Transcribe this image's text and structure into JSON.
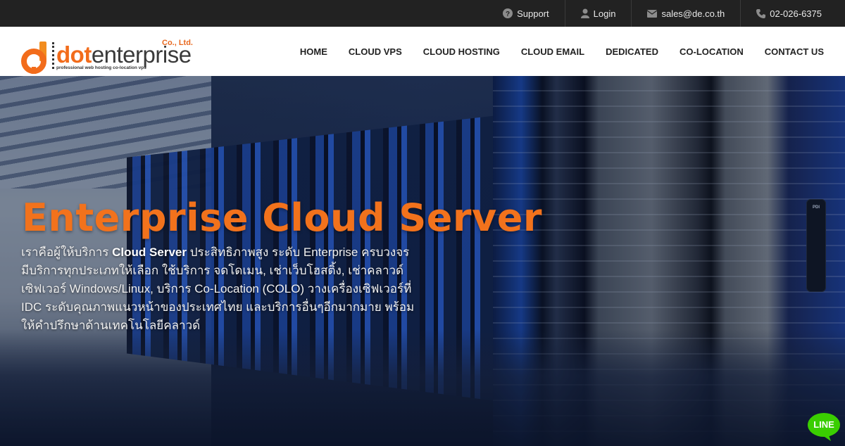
{
  "topbar": {
    "items": [
      {
        "icon": "question-circle-icon",
        "label": "Support"
      },
      {
        "icon": "user-icon",
        "label": "Login"
      },
      {
        "icon": "envelope-icon",
        "label": "sales@de.co.th"
      },
      {
        "icon": "phone-icon",
        "label": "02-026-6375"
      }
    ]
  },
  "logo": {
    "brand_dot": "dot",
    "brand_rest": "enterprise",
    "suffix": "Co., Ltd.",
    "tagline": "professional web hosting co-location vps"
  },
  "nav": {
    "items": [
      "HOME",
      "CLOUD VPS",
      "CLOUD HOSTING",
      "CLOUD EMAIL",
      "DEDICATED",
      "CO-LOCATION",
      "CONTACT US"
    ]
  },
  "hero": {
    "title": "Enterprise Cloud Server",
    "desc_prefix": "เราคือผู้ให้บริการ ",
    "desc_bold": "Cloud Server",
    "desc_suffix": " ประสิทธิภาพสูง ระดับ Enterprise ครบวงจร มีบริการทุกประเภทให้เลือก ใช้บริการ จดโดเมน, เช่าเว็บโฮสติ้ง, เช่าคลาวด์เซิฟเวอร์ Windows/Linux, บริการ Co-Location (COLO) วางเครื่องเซิฟเวอร์ที่ IDC ระดับคุณภาพแนวหน้าของประเทศไทย และบริการอื่นๆอีกมากมาย พร้อมให้คำปรึกษาด้านเทคโนโลยีคลาวด์",
    "rack_label": "PDI"
  },
  "line_button": {
    "label": "LINE",
    "color": "#3ace01"
  },
  "colors": {
    "brand_orange": "#f2721c",
    "topbar_bg": "#222222",
    "nav_text": "#222222"
  }
}
